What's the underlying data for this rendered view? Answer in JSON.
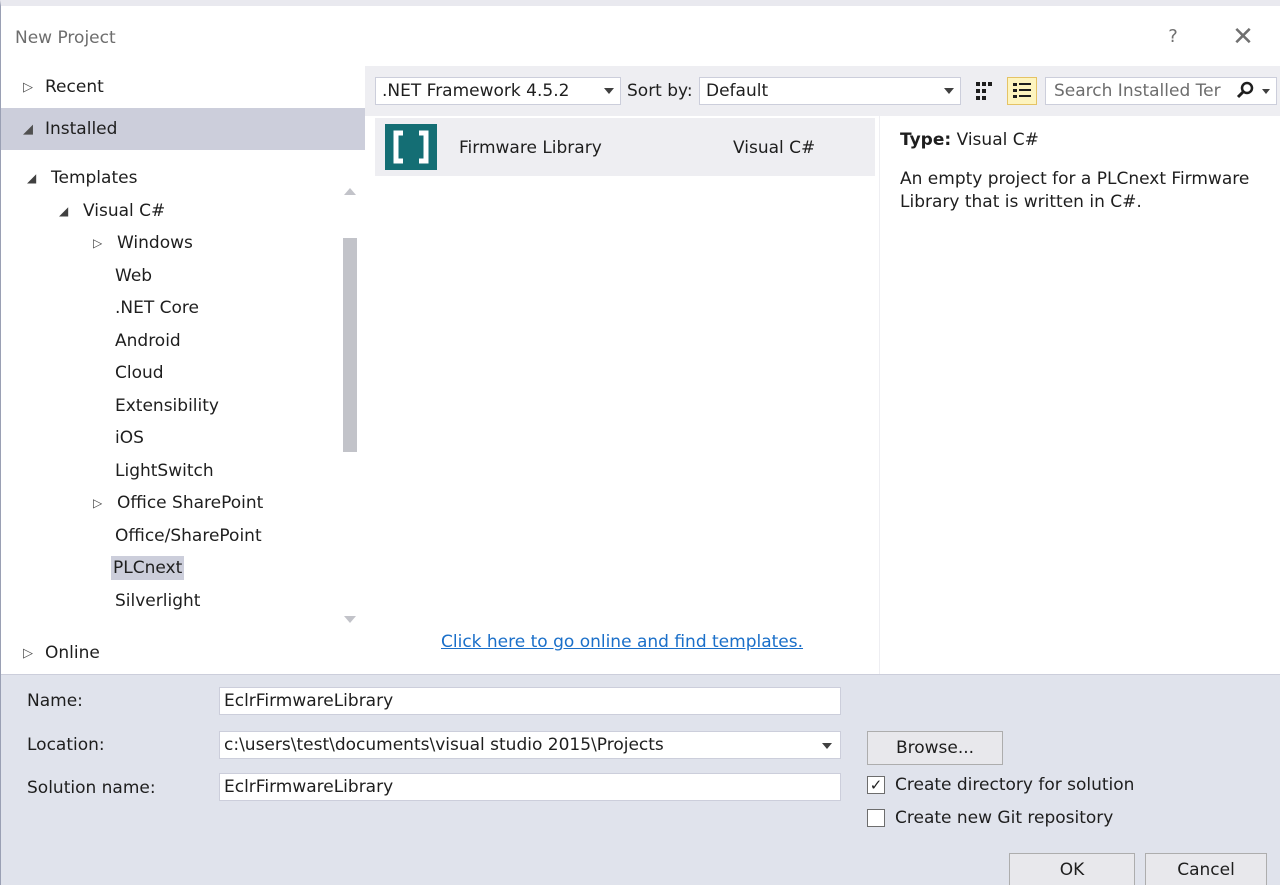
{
  "window": {
    "title": "New Project",
    "help_glyph": "?",
    "close_glyph": "✕"
  },
  "nav": {
    "recent_label": "Recent",
    "installed_label": "Installed",
    "online_label": "Online",
    "tree": {
      "templates": "Templates",
      "visual_csharp": "Visual C#",
      "items": [
        "Windows",
        "Web",
        ".NET Core",
        "Android",
        "Cloud",
        "Extensibility",
        "iOS",
        "LightSwitch",
        "Office SharePoint",
        "Office/SharePoint",
        "PLCnext",
        "Silverlight"
      ],
      "selected": "PLCnext"
    }
  },
  "toolbar": {
    "framework": ".NET Framework 4.5.2",
    "sort_label": "Sort by:",
    "sort_value": "Default",
    "search_placeholder": "Search Installed Ter"
  },
  "templates": [
    {
      "name": "Firmware Library",
      "language": "Visual C#"
    }
  ],
  "online_link": "Click here to go online and find templates.",
  "description": {
    "type_label": "Type:",
    "type_value": "Visual C#",
    "text": "An empty project for a PLCnext Firmware Library that is written in C#."
  },
  "form": {
    "name_label": "Name:",
    "name_value": "EclrFirmwareLibrary",
    "location_label": "Location:",
    "location_value": "c:\\users\\test\\documents\\visual studio 2015\\Projects",
    "solution_label": "Solution name:",
    "solution_value": "EclrFirmwareLibrary",
    "browse_label": "Browse...",
    "create_dir_label": "Create directory for solution",
    "create_dir_checked": true,
    "git_label": "Create new Git repository",
    "git_checked": false,
    "ok_label": "OK",
    "cancel_label": "Cancel"
  },
  "colors": {
    "selection": "#cccedb",
    "toolbar_bg": "#eeeef2",
    "form_bg": "#e0e3ec",
    "link": "#1a6fc9",
    "template_icon_bg": "#146e74"
  }
}
